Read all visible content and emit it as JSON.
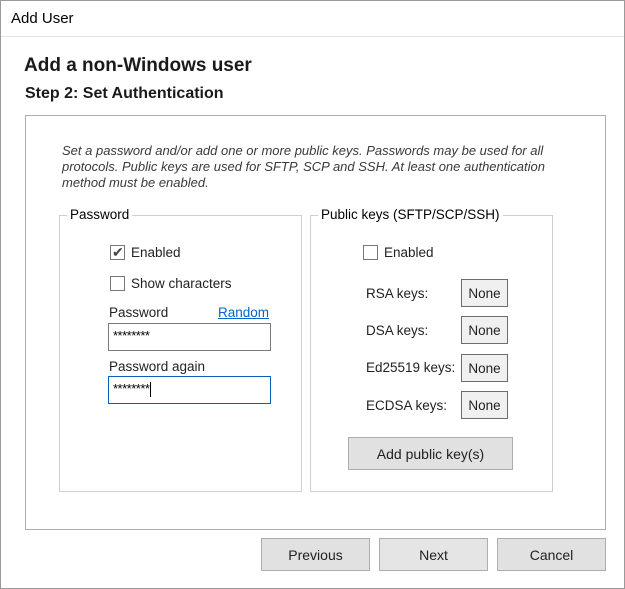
{
  "window": {
    "title": "Add User"
  },
  "header": {
    "title": "Add a non-Windows user",
    "step": "Step 2: Set Authentication"
  },
  "description": "Set a password and/or add one or more public keys.  Passwords may be used for all protocols.  Public keys are used for SFTP, SCP and SSH.  At least one authentication method must be enabled.",
  "password_group": {
    "legend": "Password",
    "enabled_label": "Enabled",
    "enabled_checked": true,
    "show_chars_label": "Show characters",
    "show_chars_checked": false,
    "password_label": "Password",
    "random_link": "Random",
    "password_value": "********",
    "password_again_label": "Password again",
    "password_again_value": "********"
  },
  "keys_group": {
    "legend": "Public keys (SFTP/SCP/SSH)",
    "enabled_label": "Enabled",
    "enabled_checked": false,
    "rsa_label": "RSA keys:",
    "rsa_value": "None",
    "dsa_label": "DSA keys:",
    "dsa_value": "None",
    "ed25519_label": "Ed25519 keys:",
    "ed25519_value": "None",
    "ecdsa_label": "ECDSA keys:",
    "ecdsa_value": "None",
    "add_button": "Add public key(s)"
  },
  "footer": {
    "previous": "Previous",
    "next": "Next",
    "cancel": "Cancel"
  },
  "icons": {
    "check": "check-icon"
  }
}
